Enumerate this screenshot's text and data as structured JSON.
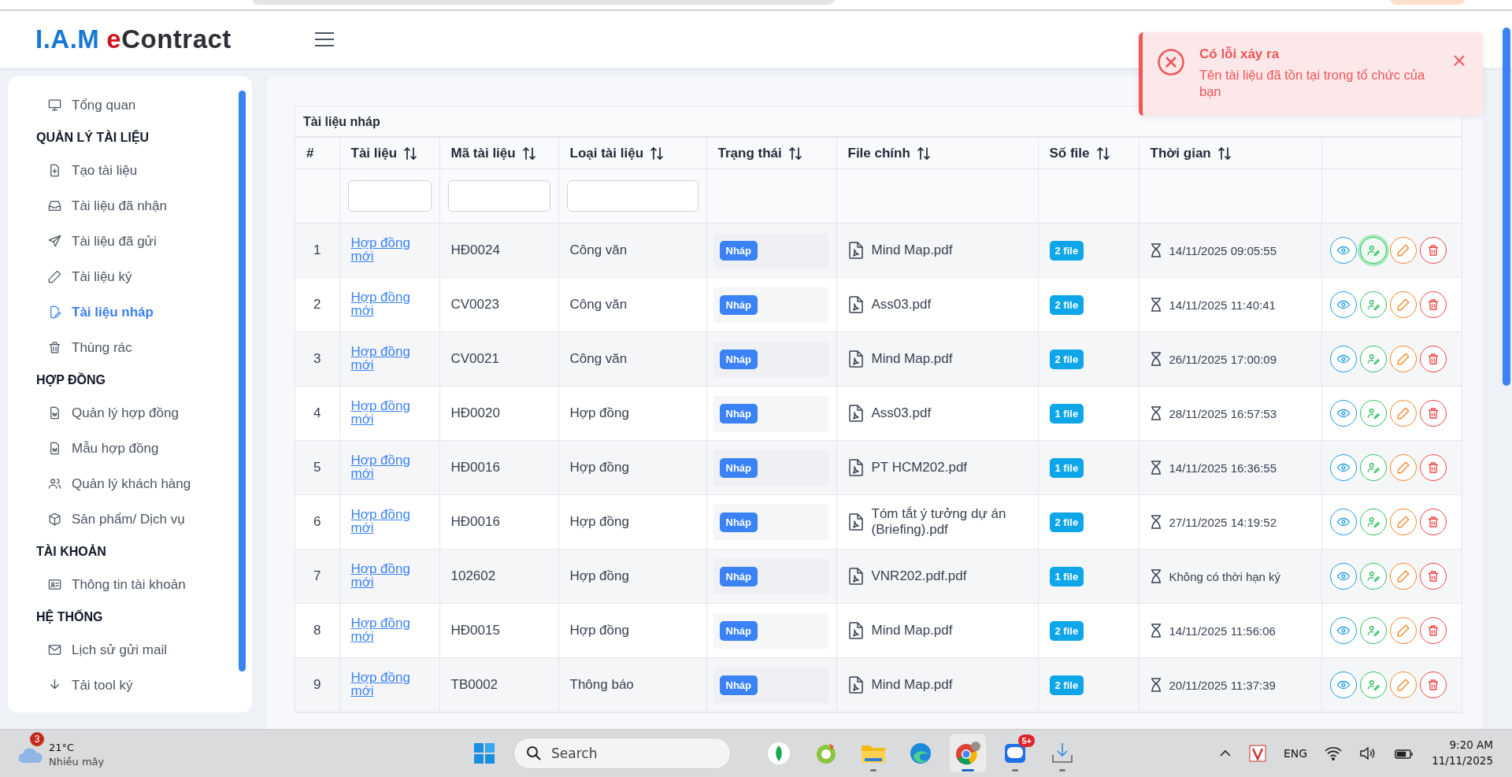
{
  "logo": {
    "prefix": "I.A.M",
    "accent": "e",
    "name": "Contract"
  },
  "sidebar": {
    "items": [
      {
        "kind": "link",
        "label": "Tổng quan",
        "selected": false
      },
      {
        "kind": "section",
        "label": "QUẢN LÝ TÀI LIỆU"
      },
      {
        "kind": "link",
        "label": "Tạo tài liệu",
        "selected": false
      },
      {
        "kind": "link",
        "label": "Tài liệu đã nhận",
        "selected": false
      },
      {
        "kind": "link",
        "label": "Tài liệu đã gửi",
        "selected": false
      },
      {
        "kind": "link",
        "label": "Tài liệu ký",
        "selected": false
      },
      {
        "kind": "link",
        "label": "Tài liệu nháp",
        "selected": true
      },
      {
        "kind": "link",
        "label": "Thùng rác",
        "selected": false
      },
      {
        "kind": "section",
        "label": "HỢP ĐỒNG"
      },
      {
        "kind": "link",
        "label": "Quản lý hợp đồng",
        "selected": false
      },
      {
        "kind": "link",
        "label": "Mẫu hợp đồng",
        "selected": false
      },
      {
        "kind": "link",
        "label": "Quản lý khách hàng",
        "selected": false
      },
      {
        "kind": "link",
        "label": "Sản phẩm/ Dịch vụ",
        "selected": false
      },
      {
        "kind": "section",
        "label": "TÀI KHOẢN"
      },
      {
        "kind": "link",
        "label": "Thông tin tài khoản",
        "selected": false
      },
      {
        "kind": "section",
        "label": "HỆ THỐNG"
      },
      {
        "kind": "link",
        "label": "Lịch sử gửi mail",
        "selected": false
      },
      {
        "kind": "link",
        "label": "Tải tool ký",
        "selected": false
      }
    ]
  },
  "table": {
    "title": "Tài liệu nháp",
    "columns": [
      {
        "label": "#",
        "sortable": false,
        "filter": false
      },
      {
        "label": "Tài liệu",
        "sortable": true,
        "filter": true
      },
      {
        "label": "Mã tài liệu",
        "sortable": true,
        "filter": true
      },
      {
        "label": "Loại tài liệu",
        "sortable": true,
        "filter": true
      },
      {
        "label": "Trạng thái",
        "sortable": true,
        "filter": false
      },
      {
        "label": "File chính",
        "sortable": true,
        "filter": false
      },
      {
        "label": "Số file",
        "sortable": true,
        "filter": false
      },
      {
        "label": "Thời gian",
        "sortable": true,
        "filter": false
      }
    ],
    "rows": [
      {
        "no": "1",
        "document": "Hợp đồng mới",
        "code": "HĐ0024",
        "type": "Công văn",
        "status": "Nháp",
        "file": "Mind Map.pdf",
        "files": "2 file",
        "time": "14/11/2025 09:05:55",
        "sign_focused": true
      },
      {
        "no": "2",
        "document": "Hợp đồng mới",
        "code": "CV0023",
        "type": "Công văn",
        "status": "Nháp",
        "file": "Ass03.pdf",
        "files": "2 file",
        "time": "14/11/2025 11:40:41",
        "sign_focused": false
      },
      {
        "no": "3",
        "document": "Hợp đồng mới",
        "code": "CV0021",
        "type": "Công văn",
        "status": "Nháp",
        "file": "Mind Map.pdf",
        "files": "2 file",
        "time": "26/11/2025 17:00:09",
        "sign_focused": false
      },
      {
        "no": "4",
        "document": "Hợp đồng mới",
        "code": "HĐ0020",
        "type": "Hợp đồng",
        "status": "Nháp",
        "file": "Ass03.pdf",
        "files": "1 file",
        "time": "28/11/2025 16:57:53",
        "sign_focused": false
      },
      {
        "no": "5",
        "document": "Hợp đồng mới",
        "code": "HĐ0016",
        "type": "Hợp đồng",
        "status": "Nháp",
        "file": "PT HCM202.pdf",
        "files": "1 file",
        "time": "14/11/2025 16:36:55",
        "sign_focused": false
      },
      {
        "no": "6",
        "document": "Hợp đồng mới",
        "code": "HĐ0016",
        "type": "Hợp đồng",
        "status": "Nháp",
        "file": "Tóm tắt ý tưởng dự án (Briefing).pdf",
        "files": "2 file",
        "time": "27/11/2025 14:19:52",
        "sign_focused": false
      },
      {
        "no": "7",
        "document": "Hợp đồng mới",
        "code": "102602",
        "type": "Hợp đồng",
        "status": "Nháp",
        "file": "VNR202.pdf.pdf",
        "files": "1 file",
        "time": "Không có thời hạn ký",
        "sign_focused": false
      },
      {
        "no": "8",
        "document": "Hợp đồng mới",
        "code": "HĐ0015",
        "type": "Hợp đồng",
        "status": "Nháp",
        "file": "Mind Map.pdf",
        "files": "2 file",
        "time": "14/11/2025 11:56:06",
        "sign_focused": false
      },
      {
        "no": "9",
        "document": "Hợp đồng mới",
        "code": "TB0002",
        "type": "Thông báo",
        "status": "Nháp",
        "file": "Mind Map.pdf",
        "files": "2 file",
        "time": "20/11/2025 11:37:39",
        "sign_focused": false
      }
    ]
  },
  "toast": {
    "title": "Có lỗi xảy ra",
    "message": "Tên tài liệu đã tồn tại trong tổ chức của bạn"
  },
  "taskbar": {
    "weather": {
      "badge": "3",
      "temperature": "21°C",
      "condition": "Nhiều mây"
    },
    "search": "Search",
    "chat_badge": "5+",
    "language": "ENG",
    "time": "9:20 AM",
    "date": "11/11/2025"
  }
}
